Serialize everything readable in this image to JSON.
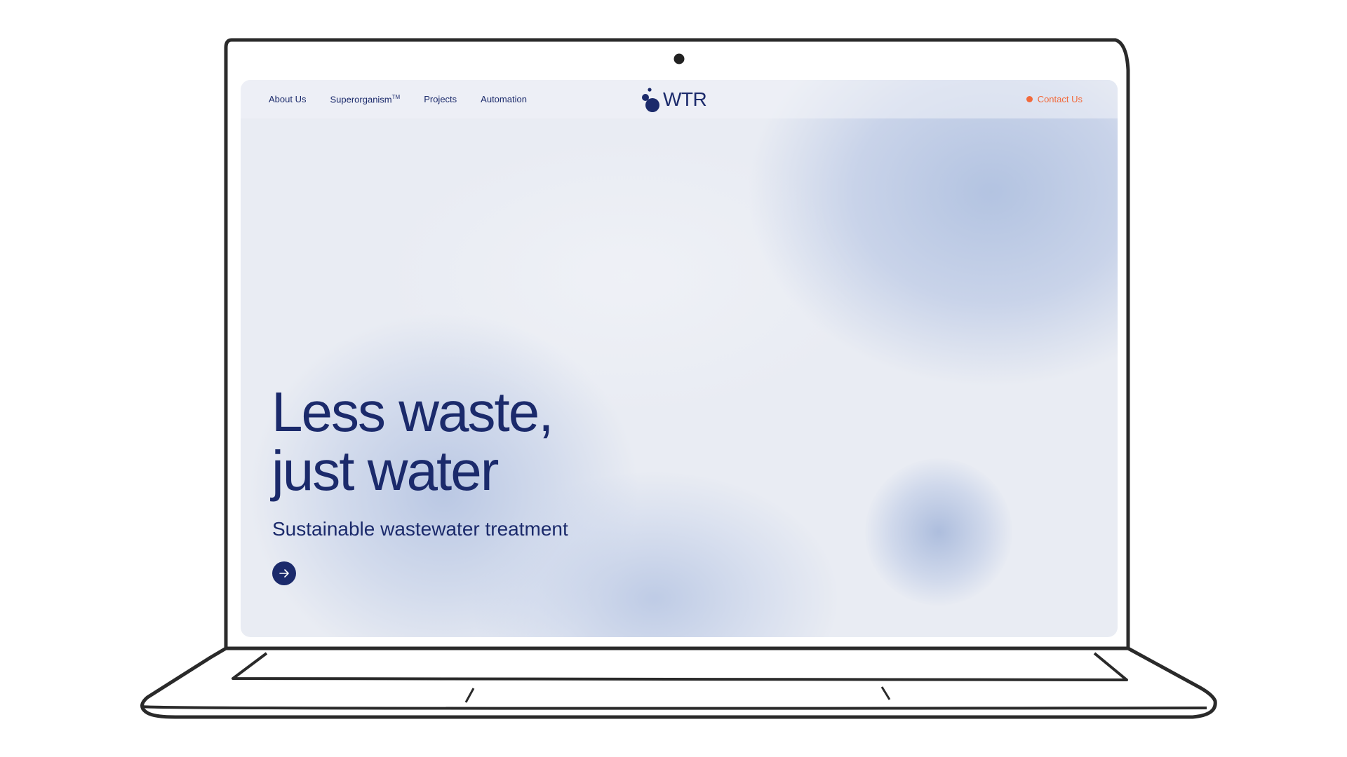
{
  "nav": {
    "links": [
      {
        "label": "About Us"
      },
      {
        "label": "Superorganism",
        "suffix": "TM"
      },
      {
        "label": "Projects"
      },
      {
        "label": "Automation"
      }
    ],
    "logo_text": "WTR",
    "contact_label": "Contact Us"
  },
  "hero": {
    "title_line1": "Less waste,",
    "title_line2": "just water",
    "subtitle": "Sustainable wastewater treatment",
    "cta_icon": "arrow-right-icon"
  },
  "colors": {
    "brand_navy": "#1b2a6b",
    "accent_orange": "#f26a3c",
    "screen_bg": "#e9ecf3"
  }
}
